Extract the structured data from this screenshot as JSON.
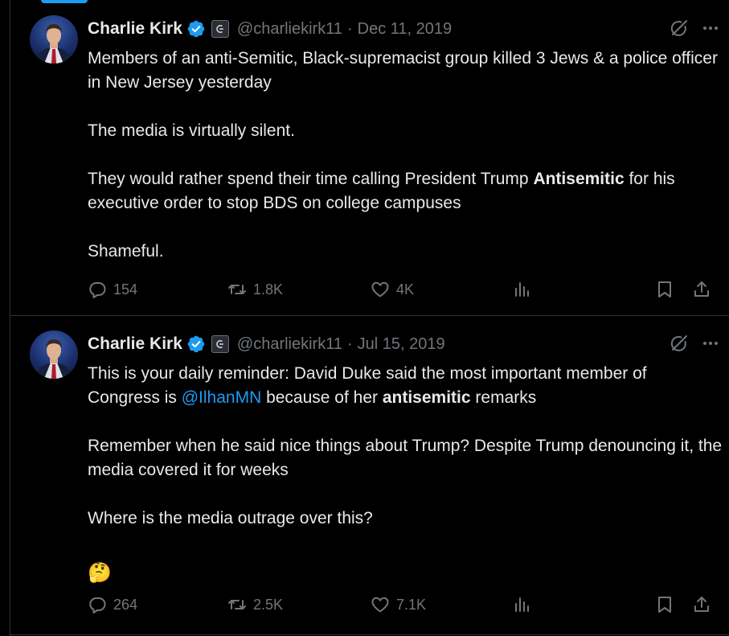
{
  "colors": {
    "background": "#000000",
    "text": "#e7e9ea",
    "muted": "#71767b",
    "accent": "#1d9bf0",
    "border": "#2f3336"
  },
  "tweets": [
    {
      "author": {
        "name": "Charlie Kirk",
        "handle": "@charliekirk11",
        "verified_icon": "verified-badge-icon",
        "affiliation_icon": "affiliate-badge-icon"
      },
      "separator": "·",
      "date": "Dec 11, 2019",
      "body": [
        {
          "text": "Members of an anti-Semitic, Black-supremacist group killed 3 Jews & a police officer in New Jersey yesterday"
        },
        {
          "text": "The media is virtually silent."
        },
        {
          "before": "They would rather spend their time calling President Trump ",
          "bold": "Antisemitic",
          "after": " for his executive order to stop BDS on college campuses"
        },
        {
          "text": "Shameful."
        }
      ],
      "metrics": {
        "replies": "154",
        "reposts": "1.8K",
        "likes": "4K",
        "views": ""
      }
    },
    {
      "author": {
        "name": "Charlie Kirk",
        "handle": "@charliekirk11",
        "verified_icon": "verified-badge-icon",
        "affiliation_icon": "affiliate-badge-icon"
      },
      "separator": "·",
      "date": "Jul 15, 2019",
      "body": [
        {
          "before": "This is your daily reminder: David Duke said the most important member of Congress is ",
          "mention": "@IlhanMN",
          "middle": " because of her ",
          "bold": "antisemitic",
          "after": " remarks"
        },
        {
          "text": "Remember when he said nice things about Trump? Despite Trump denouncing it, the media covered it for weeks"
        },
        {
          "text": "Where is the media outrage over this?"
        },
        {
          "emoji": "🤔"
        }
      ],
      "metrics": {
        "replies": "264",
        "reposts": "2.5K",
        "likes": "7.1K",
        "views": ""
      }
    }
  ]
}
